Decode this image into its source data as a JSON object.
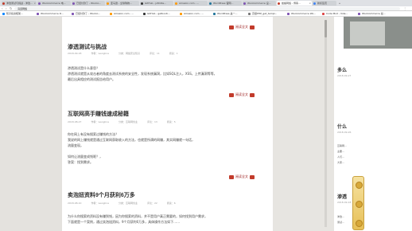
{
  "browser": {
    "tabs": [
      {
        "label": "渗透测试与挑战 - 渗透...",
        "color": "#c23b2b"
      },
      {
        "label": "WooCommerce 电...",
        "color": "#7f54b3"
      },
      {
        "label": "已经付款了 - WooCo...",
        "color": "#7f54b3"
      },
      {
        "label": "亚马逊 - 全球购物...",
        "color": "#ff9900"
      },
      {
        "label": "GitHub - jsfiddle...",
        "color": "#333333"
      },
      {
        "label": "Amazon.com - ...",
        "color": "#ff9900"
      },
      {
        "label": "WordPress 官网...",
        "color": "#21759b"
      },
      {
        "label": "WooCommerce 设...",
        "color": "#7f54b3"
      },
      {
        "label": "蛤蟆网络 - 博客...",
        "color": "#c23b2b"
      },
      {
        "label": "新标签页",
        "color": "#4285f4"
      }
    ],
    "active_tab_index": 8,
    "address": "冯道网络",
    "bookmarks": [
      {
        "label": "知乎投资框架...",
        "color": "#0084ff"
      },
      {
        "label": "WooCommerce D...",
        "color": "#7f54b3"
      },
      {
        "label": "已经付款了 - WooCo...",
        "color": "#7f54b3"
      },
      {
        "label": "Amazon.com - ...",
        "color": "#ff9900"
      },
      {
        "label": "GitHub - getbooti...",
        "color": "#333333"
      },
      {
        "label": "Amazon.com - ...",
        "color": "#ff9900"
      },
      {
        "label": "WordPress 是一...",
        "color": "#21759b"
      },
      {
        "label": "高级PHP_get_templ...",
        "color": "#777777"
      },
      {
        "label": "WooCommerce Wo...",
        "color": "#7f54b3"
      },
      {
        "label": "Code Mod - Vide...",
        "color": "#d44"
      },
      {
        "label": "WooCommerce 最...",
        "color": "#7f54b3"
      }
    ]
  },
  "ornament": {
    "text": "阅读全文"
  },
  "posts": [
    {
      "title": "渗透测试与挑战",
      "meta": [
        "2018-09-18",
        "作者：wanglina",
        "分类：网络安全知识",
        "评论：11",
        "阅读：1"
      ],
      "paragraphs": [
        "渗透测试是什么意思？",
        "渗透测试就是从攻击者的角度去测试系统的安全性，发现系统漏洞，比如SQL注入，XSS，上传漏洞等等，",
        "最后出具相应的测试报告给用户。"
      ]
    },
    {
      "title": "互联网高手赚钱速成秘籍",
      "meta": [
        "2018-08-27",
        "作者：wanglina",
        "分类：互联网创业",
        "评论：13",
        "阅读：5"
      ],
      "paragraphs": [
        "你在网上有没有搜索过赚钱的方法？",
        "我说的网上赚钱就是通过互联网获取收入的方法，也就是所谓的网赚，其实网赚就一句话，",
        "流量变现。",
        "如何让流量变成钱呢？，",
        "答案：找到需求。"
      ]
    },
    {
      "title": "卖泡妞资料9个月获利6万多",
      "meta": [
        "2018-08-10",
        "作者：wanglina",
        "分类：互联网创业",
        "评论：22",
        "阅读：6"
      ],
      "paragraphs": [
        "为什么你搜索的资料没有赚到钱，因为你搜索的资料，并不是用户真正需要的，如何找到用户需求，",
        "下面就是一个案例，通过卖泡妞资料，9个月获利6万多，具体操作方法如下……"
      ]
    }
  ],
  "sidebar": {
    "section1": {
      "title": "多么",
      "meta": "2018-09-27"
    },
    "section2": {
      "title": "什么",
      "meta": "2018-09-26",
      "lines": [
        "互联网...",
        "主要...",
        "人们...",
        "大家..."
      ]
    },
    "section3": {
      "title": "渗透",
      "meta": "2018-09-18",
      "lines": [
        "渗透...",
        "测试..."
      ]
    }
  }
}
